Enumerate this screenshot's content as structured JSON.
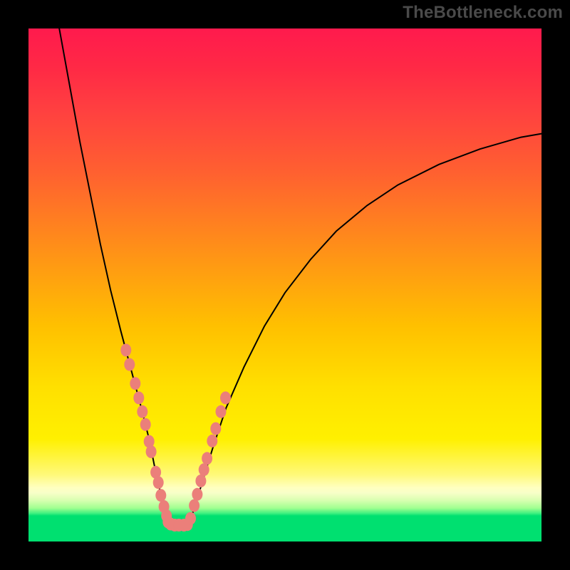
{
  "watermark": "TheBottleneck.com",
  "chart_data": {
    "type": "line",
    "title": "",
    "xlabel": "",
    "ylabel": "",
    "xlim": [
      0,
      100
    ],
    "ylim": [
      0,
      100
    ],
    "background_gradient": [
      "#ff1a4d",
      "#ffc000",
      "#fff97a",
      "#00e070"
    ],
    "curve_left": {
      "x": [
        6,
        8,
        10,
        12,
        14,
        16,
        18,
        20,
        22,
        23.5,
        24.5,
        25.5,
        26.5,
        27.2
      ],
      "y": [
        100,
        89,
        78,
        68,
        58,
        49,
        41,
        33.5,
        26,
        20,
        15,
        10.5,
        6.5,
        3.5
      ]
    },
    "curve_right": {
      "x": [
        31.3,
        32.5,
        34,
        36,
        38.5,
        42,
        46,
        50,
        55,
        60,
        66,
        72,
        80,
        88,
        96,
        100
      ],
      "y": [
        3.5,
        7,
        12,
        18.5,
        26,
        34,
        42,
        48.5,
        55,
        60.5,
        65.5,
        69.5,
        73.5,
        76.5,
        78.8,
        79.5
      ]
    },
    "flat_bottom": {
      "x": [
        27.2,
        31.3
      ],
      "y": [
        3.2,
        3.2
      ]
    },
    "dots_left": {
      "x": [
        19.0,
        19.7,
        20.8,
        21.5,
        22.2,
        22.8,
        23.5,
        23.9,
        24.8,
        25.3,
        25.8,
        26.4,
        26.9,
        27.2,
        27.7,
        28.5,
        29.3,
        30.3,
        31.0
      ],
      "y": [
        37.3,
        34.5,
        30.8,
        28.0,
        25.3,
        22.8,
        19.5,
        17.5,
        13.5,
        11.5,
        9.0,
        6.8,
        5.0,
        3.8,
        3.4,
        3.2,
        3.2,
        3.2,
        3.3
      ]
    },
    "dots_right": {
      "x": [
        31.6,
        32.3,
        32.9,
        33.6,
        34.2,
        34.8,
        35.8,
        36.5,
        37.5,
        38.4
      ],
      "y": [
        4.5,
        7.0,
        9.2,
        11.8,
        14.0,
        16.2,
        19.6,
        22.0,
        25.3,
        28.0
      ]
    },
    "dot_color": "#eb7f7a",
    "curve_color": "#000000"
  }
}
